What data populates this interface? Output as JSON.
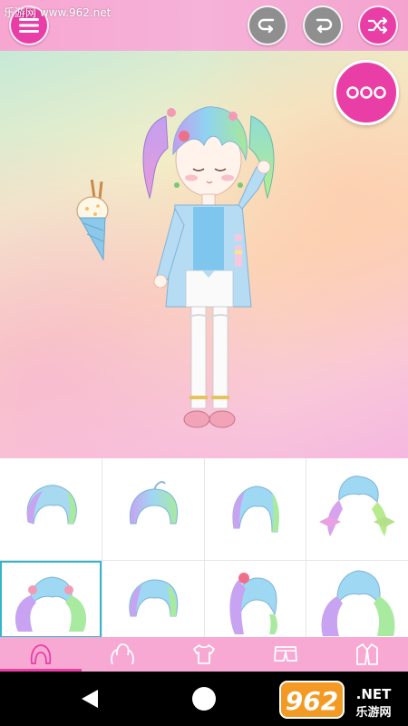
{
  "watermark": "乐游网 www.962.net",
  "toolbar": {
    "menu_icon": "hamburger-icon",
    "undo_icon": "undo-icon",
    "redo_icon": "redo-icon",
    "shuffle_icon": "shuffle-icon",
    "more_icon": "more-dots-icon"
  },
  "categories": [
    {
      "name": "hair",
      "icon": "hair-icon",
      "active": true
    },
    {
      "name": "hair-accessory",
      "icon": "pigtails-icon",
      "active": false
    },
    {
      "name": "top",
      "icon": "shirt-icon",
      "active": false
    },
    {
      "name": "bottom",
      "icon": "shorts-icon",
      "active": false
    },
    {
      "name": "outerwear",
      "icon": "jacket-icon",
      "active": false
    }
  ],
  "hair_options": [
    {
      "style": "bob",
      "selected": false
    },
    {
      "style": "short-ahoge",
      "selected": false
    },
    {
      "style": "side-swept",
      "selected": false
    },
    {
      "style": "twin-ribbons",
      "selected": false
    },
    {
      "style": "twin-tails-bows",
      "selected": true
    },
    {
      "style": "short-rounded",
      "selected": false
    },
    {
      "style": "side-ponytail",
      "selected": false
    },
    {
      "style": "long-wavy",
      "selected": false
    }
  ],
  "brand_logo": {
    "text_main": "962",
    "text_net": ".NET",
    "text_sub": "乐游网"
  },
  "colors": {
    "accent": "#e83ea6",
    "topbar": "#f7a8d3",
    "selected_outline": "#33b7c8"
  }
}
